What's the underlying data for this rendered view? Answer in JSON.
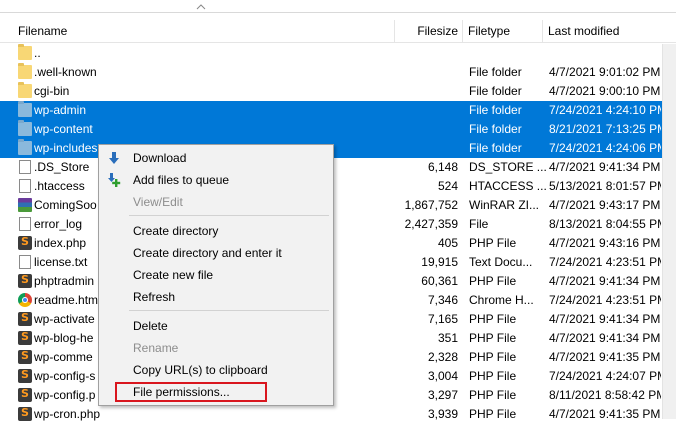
{
  "columns": {
    "filename": "Filename",
    "filesize": "Filesize",
    "filetype": "Filetype",
    "last_modified": "Last modified"
  },
  "files": [
    {
      "name": "..",
      "size": "",
      "type": "",
      "modified": "",
      "icon": "folder-icon",
      "selected": false
    },
    {
      "name": ".well-known",
      "size": "",
      "type": "File folder",
      "modified": "4/7/2021 9:01:02 PM",
      "icon": "folder-icon",
      "selected": false
    },
    {
      "name": "cgi-bin",
      "size": "",
      "type": "File folder",
      "modified": "4/7/2021 9:00:10 PM",
      "icon": "folder-icon",
      "selected": false
    },
    {
      "name": "wp-admin",
      "size": "",
      "type": "File folder",
      "modified": "7/24/2021 4:24:10 PM",
      "icon": "folder-icon",
      "selected": true
    },
    {
      "name": "wp-content",
      "size": "",
      "type": "File folder",
      "modified": "8/21/2021 7:13:25 PM",
      "icon": "folder-icon",
      "selected": true
    },
    {
      "name": "wp-includes",
      "size": "",
      "type": "File folder",
      "modified": "7/24/2021 4:24:06 PM",
      "icon": "folder-icon",
      "selected": true
    },
    {
      "name": ".DS_Store",
      "size": "6,148",
      "type": "DS_STORE ...",
      "modified": "4/7/2021 9:41:34 PM",
      "icon": "document-icon",
      "selected": false
    },
    {
      "name": ".htaccess",
      "size": "524",
      "type": "HTACCESS ...",
      "modified": "5/13/2021 8:01:57 PM",
      "icon": "document-icon",
      "selected": false
    },
    {
      "name": "ComingSoo",
      "size": "1,867,752",
      "type": "WinRAR ZI...",
      "modified": "4/7/2021 9:43:17 PM",
      "icon": "winrar-icon",
      "selected": false
    },
    {
      "name": "error_log",
      "size": "2,427,359",
      "type": "File",
      "modified": "8/13/2021 8:04:55 PM",
      "icon": "document-icon",
      "selected": false
    },
    {
      "name": "index.php",
      "size": "405",
      "type": "PHP File",
      "modified": "4/7/2021 9:43:16 PM",
      "icon": "php-file-icon",
      "selected": false
    },
    {
      "name": "license.txt",
      "size": "19,915",
      "type": "Text Docu...",
      "modified": "7/24/2021 4:23:51 PM",
      "icon": "document-icon",
      "selected": false
    },
    {
      "name": "phptradmin",
      "size": "60,361",
      "type": "PHP File",
      "modified": "4/7/2021 9:41:34 PM",
      "icon": "php-file-icon",
      "selected": false
    },
    {
      "name": "readme.htm",
      "size": "7,346",
      "type": "Chrome H...",
      "modified": "7/24/2021 4:23:51 PM",
      "icon": "chrome-icon",
      "selected": false
    },
    {
      "name": "wp-activate",
      "size": "7,165",
      "type": "PHP File",
      "modified": "4/7/2021 9:41:34 PM",
      "icon": "php-file-icon",
      "selected": false
    },
    {
      "name": "wp-blog-he",
      "size": "351",
      "type": "PHP File",
      "modified": "4/7/2021 9:41:34 PM",
      "icon": "php-file-icon",
      "selected": false
    },
    {
      "name": "wp-comme",
      "size": "2,328",
      "type": "PHP File",
      "modified": "4/7/2021 9:41:35 PM",
      "icon": "php-file-icon",
      "selected": false
    },
    {
      "name": "wp-config-s",
      "size": "3,004",
      "type": "PHP File",
      "modified": "7/24/2021 4:24:07 PM",
      "icon": "php-file-icon",
      "selected": false
    },
    {
      "name": "wp-config.p",
      "size": "3,297",
      "type": "PHP File",
      "modified": "8/11/2021 8:58:42 PM",
      "icon": "php-file-icon",
      "selected": false
    },
    {
      "name": "wp-cron.php",
      "size": "3,939",
      "type": "PHP File",
      "modified": "4/7/2021 9:41:35 PM",
      "icon": "php-file-icon",
      "selected": false
    }
  ],
  "context_menu": {
    "download": "Download",
    "add_files": "Add files to queue",
    "view_edit": "View/Edit",
    "create_directory": "Create directory",
    "create_directory_enter": "Create directory and enter it",
    "create_new_file": "Create new file",
    "refresh": "Refresh",
    "delete": "Delete",
    "rename": "Rename",
    "copy_urls": "Copy URL(s) to clipboard",
    "file_permissions": "File permissions..."
  },
  "colors": {
    "selection": "#0078d7",
    "highlight_box": "#d9161e",
    "menu_background": "#f2f2f2"
  }
}
